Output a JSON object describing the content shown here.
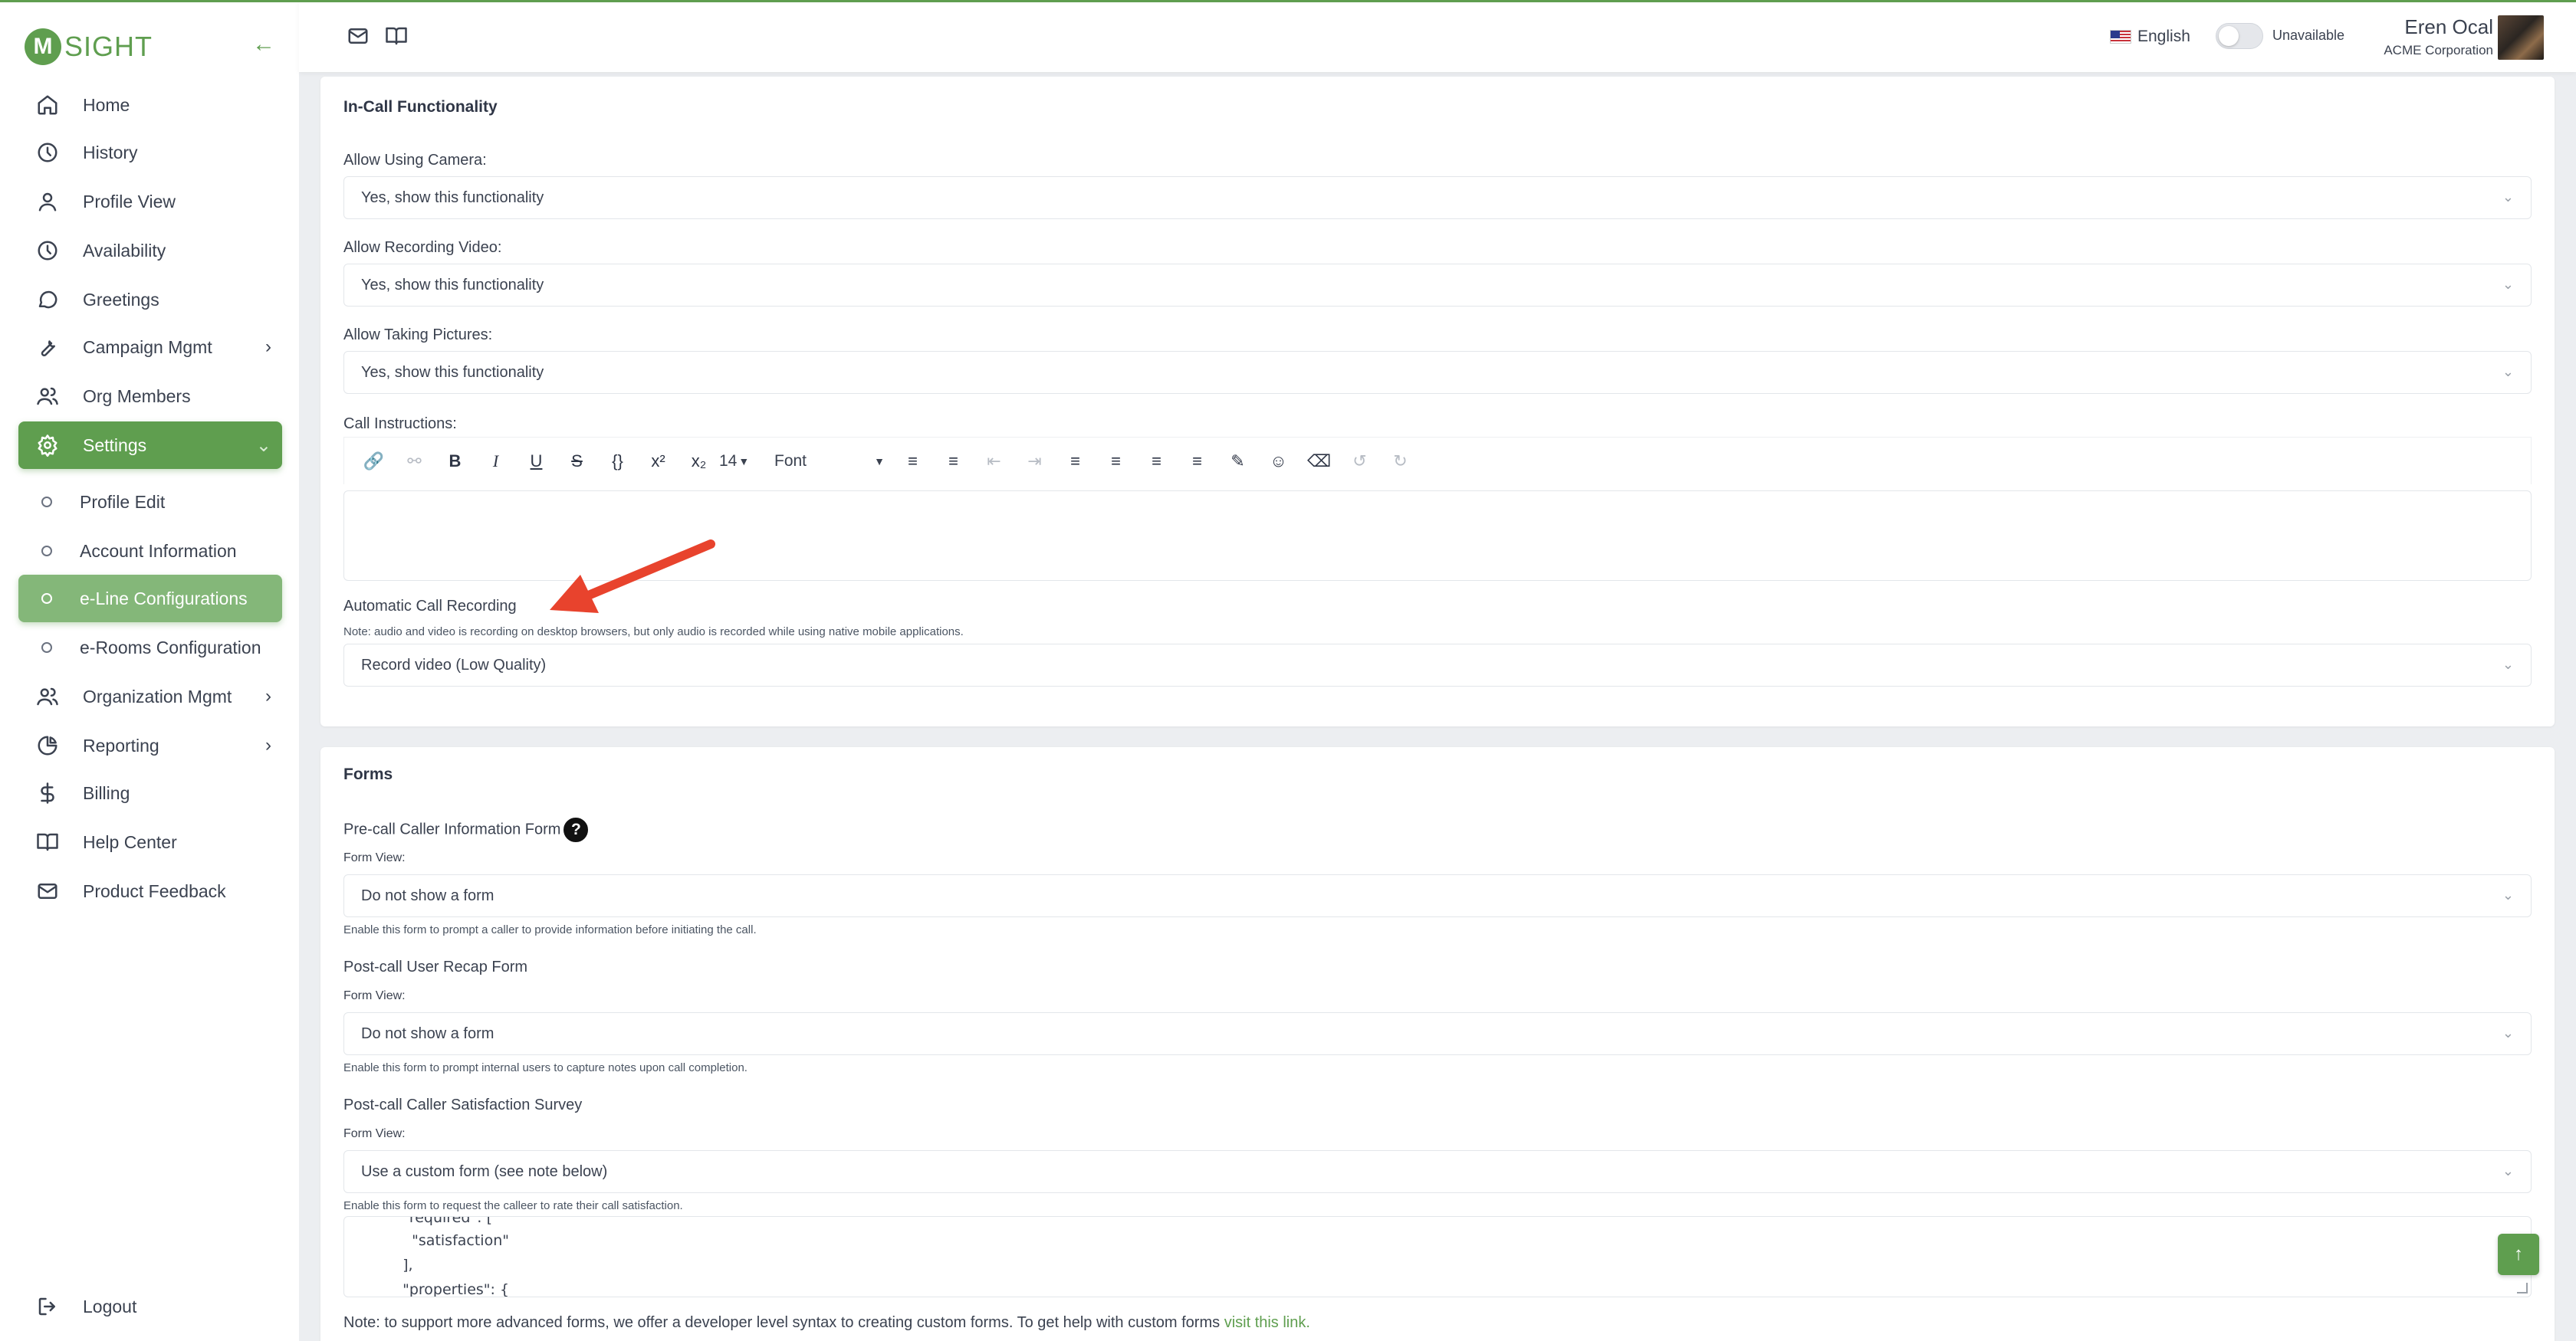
{
  "brand": {
    "logo_letter": "M",
    "logo_text": "SIGHT",
    "accent": "#5f9e4f"
  },
  "sidebar": {
    "items": [
      {
        "label": "Home",
        "icon": "home-icon"
      },
      {
        "label": "History",
        "icon": "clock-icon"
      },
      {
        "label": "Profile View",
        "icon": "user-icon"
      },
      {
        "label": "Availability",
        "icon": "clock-icon"
      },
      {
        "label": "Greetings",
        "icon": "chat-bubble-icon"
      },
      {
        "label": "Campaign Mgmt",
        "icon": "wrench-icon"
      },
      {
        "label": "Org Members",
        "icon": "users-icon"
      },
      {
        "label": "Settings",
        "icon": "gear-icon"
      },
      {
        "label": "Profile Edit"
      },
      {
        "label": "Account Information"
      },
      {
        "label": "e-Line Configurations"
      },
      {
        "label": "e-Rooms Configuration"
      },
      {
        "label": "Organization Mgmt",
        "icon": "users-icon"
      },
      {
        "label": "Reporting",
        "icon": "pie-chart-icon"
      },
      {
        "label": "Billing",
        "icon": "dollar-icon"
      },
      {
        "label": "Help Center",
        "icon": "book-icon"
      },
      {
        "label": "Product Feedback",
        "icon": "mail-icon"
      }
    ],
    "logout": "Logout"
  },
  "topbar": {
    "language": "English",
    "status": "Unavailable",
    "user_name": "Eren Ocal",
    "user_org": "ACME Corporation"
  },
  "in_call": {
    "title": "In-Call Functionality",
    "camera_label": "Allow Using Camera:",
    "camera_value": "Yes, show this functionality",
    "recording_label": "Allow Recording Video:",
    "recording_value": "Yes, show this functionality",
    "pictures_label": "Allow Taking Pictures:",
    "pictures_value": "Yes, show this functionality",
    "instructions_label": "Call Instructions:",
    "toolbar": {
      "font_size": "14",
      "font": "Font"
    },
    "auto_recording_label": "Automatic Call Recording",
    "auto_recording_note": "Note: audio and video is recording on desktop browsers, but only audio is recorded while using native mobile applications.",
    "auto_recording_value": "Record video (Low Quality)"
  },
  "forms": {
    "title": "Forms",
    "precall_label": "Pre-call Caller Information Form",
    "precall_view_label": "Form View:",
    "precall_value": "Do not show a form",
    "precall_note": "Enable this form to prompt a caller to provide information before initiating the call.",
    "recap_label": "Post-call User Recap Form",
    "recap_view_label": "Form View:",
    "recap_value": "Do not show a form",
    "recap_note": "Enable this form to prompt internal users to capture notes upon call completion.",
    "survey_label": "Post-call Caller Satisfaction Survey",
    "survey_view_label": "Form View:",
    "survey_value": "Use a custom form (see note below)",
    "survey_note": "Enable this form to request the calleer to rate their call satisfaction.",
    "code_lines": [
      "  \"required\": [",
      "    \"satisfaction\"",
      "  ],",
      "  \"properties\": {"
    ],
    "footer_note": "Note: to support more advanced forms, we offer a developer level syntax to creating custom forms. To get help with custom forms",
    "footer_link": "visit this link."
  }
}
